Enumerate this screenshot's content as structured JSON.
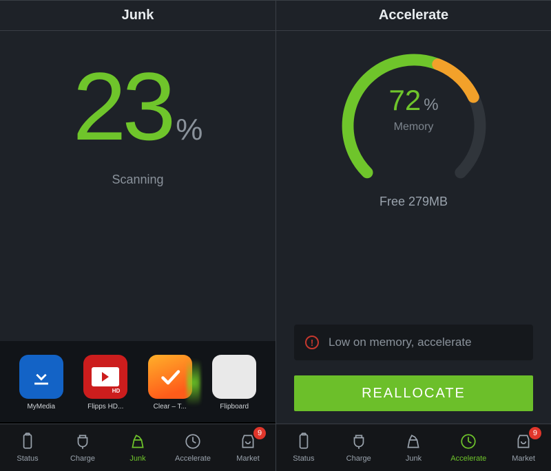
{
  "left": {
    "title": "Junk",
    "percent": "23",
    "percent_sym": "%",
    "status": "Scanning",
    "apps": [
      {
        "name": "MyMedia"
      },
      {
        "name": "Flipps HD..."
      },
      {
        "name": "Clear – T..."
      },
      {
        "name": "Flipboard"
      }
    ]
  },
  "right": {
    "title": "Accelerate",
    "gauge_value": "72",
    "gauge_sym": "%",
    "gauge_label": "Memory",
    "free_text": "Free 279MB",
    "warning": "Low on memory, accelerate",
    "button": "REALLOCATE"
  },
  "nav_left": {
    "items": [
      {
        "label": "Status"
      },
      {
        "label": "Charge"
      },
      {
        "label": "Junk"
      },
      {
        "label": "Accelerate"
      },
      {
        "label": "Market",
        "badge": "9"
      }
    ],
    "active_index": 2
  },
  "nav_right": {
    "items": [
      {
        "label": "Status"
      },
      {
        "label": "Charge"
      },
      {
        "label": "Junk"
      },
      {
        "label": "Accelerate"
      },
      {
        "label": "Market",
        "badge": "9"
      }
    ],
    "active_index": 3
  },
  "colors": {
    "accent": "#6fc52b",
    "warn": "#c5382e",
    "orange": "#f2a12a"
  }
}
